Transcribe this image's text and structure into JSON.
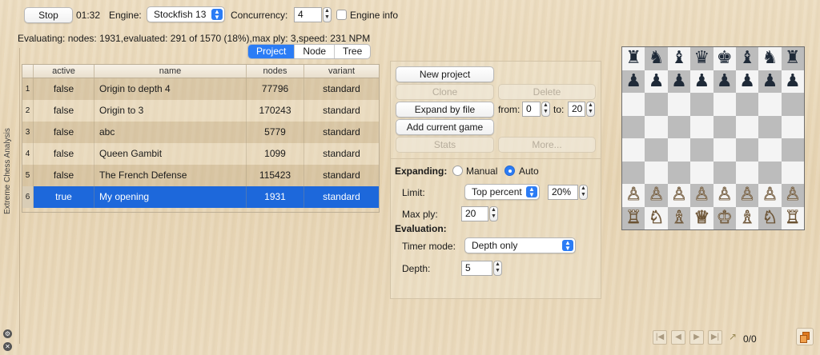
{
  "toolbar": {
    "stop_label": "Stop",
    "timer": "01:32",
    "engine_label": "Engine:",
    "engine_value": "Stockfish 13",
    "concurrency_label": "Concurrency:",
    "concurrency_value": "4",
    "engine_info_label": "Engine info"
  },
  "status_text": "Evaluating: nodes: 1931,evaluated: 291 of 1570 (18%),max ply: 3,speed: 231 NPM",
  "tabs": [
    {
      "label": "Project",
      "selected": true
    },
    {
      "label": "Node",
      "selected": false
    },
    {
      "label": "Tree",
      "selected": false
    }
  ],
  "table": {
    "headers": [
      "active",
      "name",
      "nodes",
      "variant"
    ],
    "rows": [
      {
        "num": "1",
        "active": "false",
        "name": "Origin to depth 4",
        "nodes": "77796",
        "variant": "standard"
      },
      {
        "num": "2",
        "active": "false",
        "name": "Origin to 3",
        "nodes": "170243",
        "variant": "standard"
      },
      {
        "num": "3",
        "active": "false",
        "name": "abc",
        "nodes": "5779",
        "variant": "standard"
      },
      {
        "num": "4",
        "active": "false",
        "name": "Queen Gambit",
        "nodes": "1099",
        "variant": "standard"
      },
      {
        "num": "5",
        "active": "false",
        "name": "The French Defense",
        "nodes": "115423",
        "variant": "standard"
      },
      {
        "num": "6",
        "active": "true",
        "name": "My opening",
        "nodes": "1931",
        "variant": "standard"
      }
    ]
  },
  "project_panel": {
    "new_project": "New project",
    "clone": "Clone",
    "delete": "Delete",
    "expand_by_file": "Expand by file",
    "from_label": "from:",
    "from_value": "0",
    "to_label": "to:",
    "to_value": "20",
    "add_current_game": "Add current game",
    "stats": "Stats",
    "more": "More..."
  },
  "expanding": {
    "label": "Expanding:",
    "manual_label": "Manual",
    "auto_label": "Auto",
    "selected": "Auto",
    "limit_label": "Limit:",
    "limit_mode": "Top percent",
    "limit_value": "20%",
    "max_ply_label": "Max ply:",
    "max_ply_value": "20"
  },
  "evaluation": {
    "label": "Evaluation:",
    "timer_mode_label": "Timer mode:",
    "timer_mode_value": "Depth only",
    "depth_label": "Depth:",
    "depth_value": "5"
  },
  "sidebar_label": "Extreme Chess Analysis",
  "board": {
    "ranks": [
      [
        "♜",
        "♞",
        "♝",
        "♛",
        "♚",
        "♝",
        "♞",
        "♜"
      ],
      [
        "♟",
        "♟",
        "♟",
        "♟",
        "♟",
        "♟",
        "♟",
        "♟"
      ],
      [
        "",
        "",
        "",
        "",
        "",
        "",
        "",
        ""
      ],
      [
        "",
        "",
        "",
        "",
        "",
        "",
        "",
        ""
      ],
      [
        "",
        "",
        "",
        "",
        "",
        "",
        "",
        ""
      ],
      [
        "",
        "",
        "",
        "",
        "",
        "",
        "",
        ""
      ],
      [
        "♙",
        "♙",
        "♙",
        "♙",
        "♙",
        "♙",
        "♙",
        "♙"
      ],
      [
        "♖",
        "♘",
        "♗",
        "♕",
        "♔",
        "♗",
        "♘",
        "♖"
      ]
    ]
  },
  "navigation": {
    "move_counter": "0/0"
  },
  "colors": {
    "accent": "#2b7cf5",
    "selected_row": "#1d68db"
  }
}
